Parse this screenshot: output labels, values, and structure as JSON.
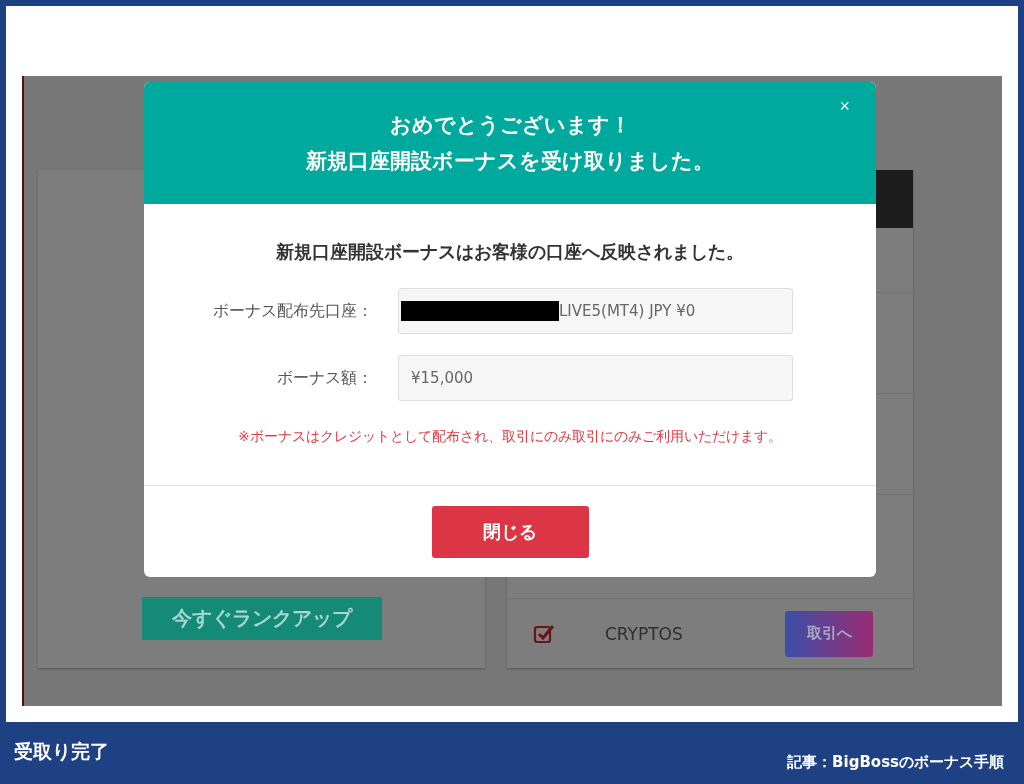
{
  "background_page": {
    "rank_button": "今すぐランクアップ",
    "accounts": [
      {
        "name": "CRYPTOS",
        "checked": true,
        "action": "取引へ"
      }
    ]
  },
  "modal": {
    "title_lines": [
      "おめでとうございます！",
      "新規口座開設ボーナスを受け取りました。"
    ],
    "close": "×",
    "message": "新規口座開設ボーナスはお客様の口座へ反映されました。",
    "fields": [
      {
        "label": "ボーナス配布先口座：",
        "value": "LIVE5(MT4) JPY ¥0",
        "redacted": true
      },
      {
        "label": "ボーナス額：",
        "value": "¥15,000",
        "redacted": false
      }
    ],
    "note": "※ボーナスはクレジットとして配布され、取引にのみ取引にのみご利用いただけます。",
    "close_button": "閉じる"
  },
  "article": {
    "caption": "受取り完了",
    "source": "記事：BigBossのボーナス手順"
  }
}
